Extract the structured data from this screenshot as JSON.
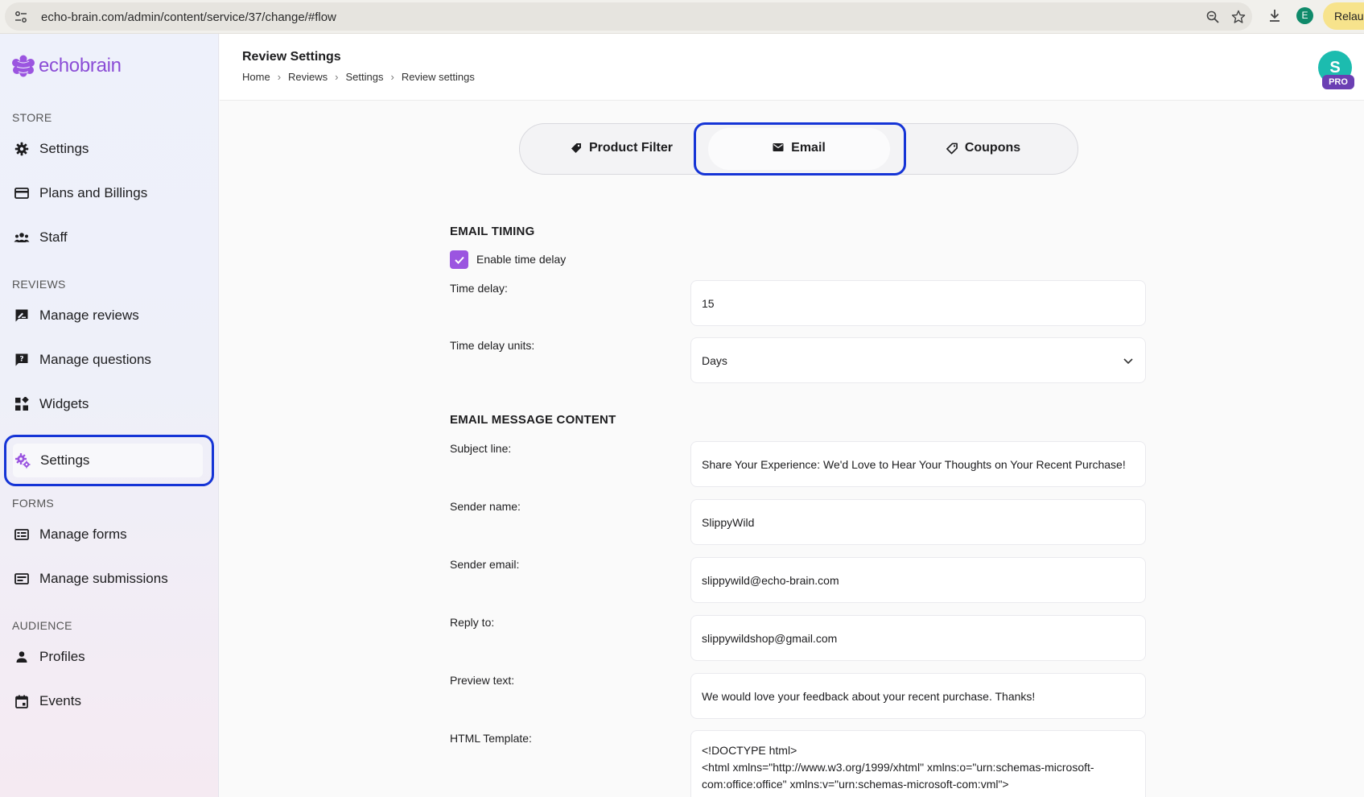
{
  "browser": {
    "url": "echo-brain.com/admin/content/service/37/change/#flow",
    "profile_initial": "E",
    "relaunch_label": "Relaunch"
  },
  "sidebar": {
    "logo_text": "echobrain",
    "sections": {
      "store": "STORE",
      "reviews": "REVIEWS",
      "forms": "FORMS",
      "audience": "AUDIENCE"
    },
    "items": {
      "store_settings": "Settings",
      "plans": "Plans and Billings",
      "staff": "Staff",
      "manage_reviews": "Manage reviews",
      "manage_questions": "Manage questions",
      "widgets": "Widgets",
      "review_settings": "Settings",
      "manage_forms": "Manage forms",
      "manage_submissions": "Manage submissions",
      "profiles": "Profiles",
      "events": "Events"
    }
  },
  "header": {
    "title": "Review Settings",
    "breadcrumb": [
      "Home",
      "Reviews",
      "Settings",
      "Review settings"
    ],
    "avatar_initial": "S",
    "badge": "PRO"
  },
  "tabs": {
    "product_filter": "Product Filter",
    "email": "Email",
    "coupons": "Coupons"
  },
  "form": {
    "timing_heading": "EMAIL TIMING",
    "enable_delay_label": "Enable time delay",
    "time_delay_label": "Time delay:",
    "time_delay_value": "15",
    "units_label": "Time delay units:",
    "units_value": "Days",
    "content_heading": "EMAIL MESSAGE CONTENT",
    "subject_label": "Subject line:",
    "subject_value": "Share Your Experience: We'd Love to Hear Your Thoughts on Your Recent Purchase!",
    "sender_name_label": "Sender name:",
    "sender_name_value": "SlippyWild",
    "sender_email_label": "Sender email:",
    "sender_email_value": "slippywild@echo-brain.com",
    "reply_to_label": "Reply to:",
    "reply_to_value": "slippywildshop@gmail.com",
    "preview_label": "Preview text:",
    "preview_value": "We would love your feedback about your recent purchase. Thanks!",
    "template_label": "HTML Template:",
    "template_line1": "<!DOCTYPE html>",
    "template_line2": "<html xmlns=\"http://www.w3.org/1999/xhtml\" xmlns:o=\"urn:schemas-microsoft-com:office:office\" xmlns:v=\"urn:schemas-microsoft-com:vml\">"
  },
  "colors": {
    "accent": "#9b55e0",
    "focus_ring": "#1534d6",
    "avatar": "#1cbcaf",
    "badge": "#6b3fb3"
  }
}
